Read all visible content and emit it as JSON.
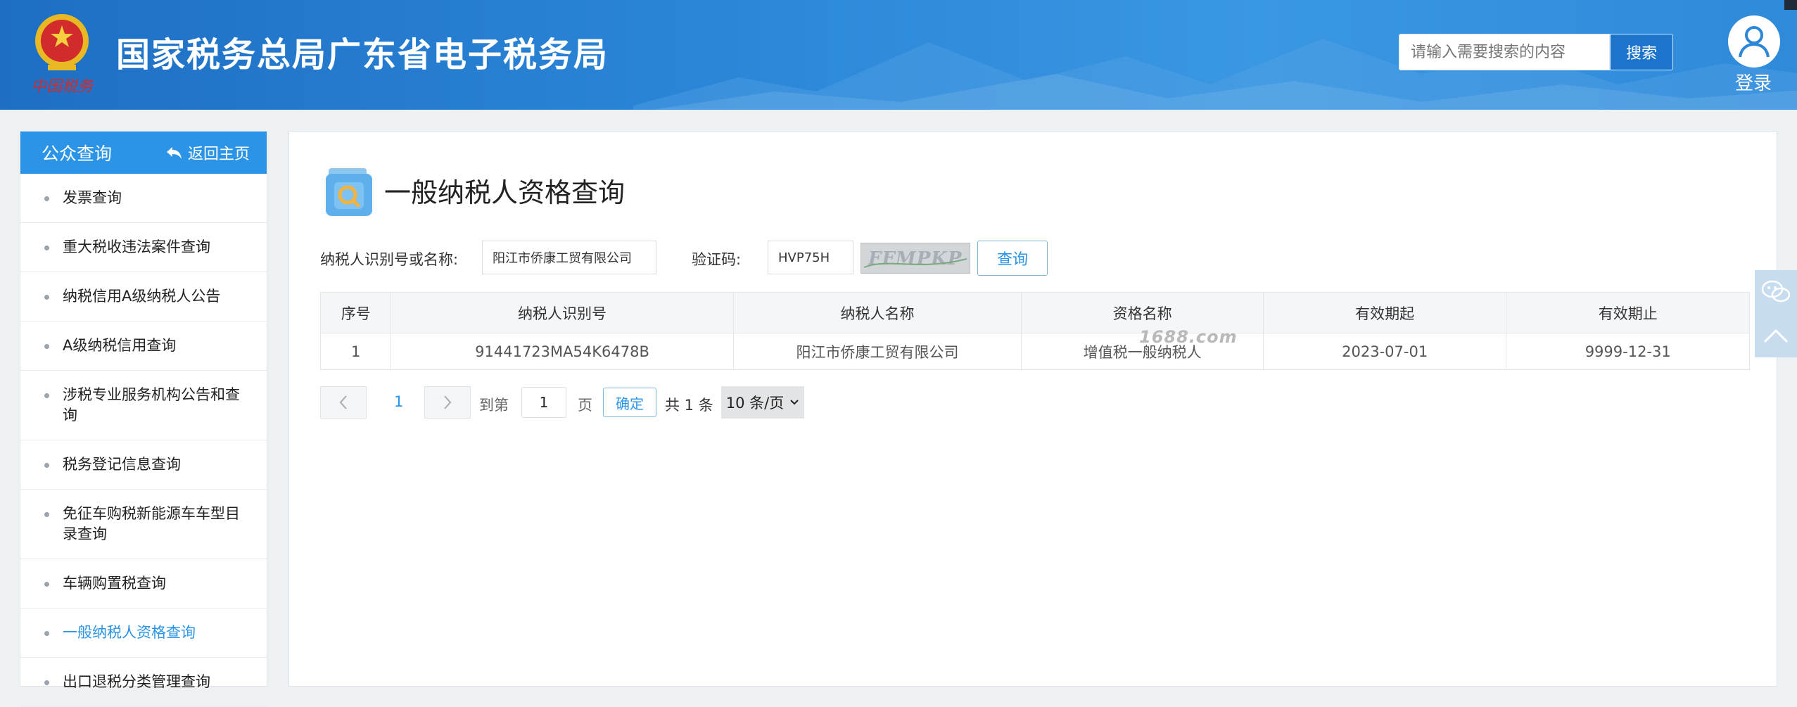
{
  "header": {
    "site_title": "国家税务总局广东省电子税务局",
    "search_placeholder": "请输入需要搜索的内容",
    "search_button": "搜索",
    "login": "登录"
  },
  "sidebar": {
    "title": "公众查询",
    "back_label": "返回主页",
    "items": [
      {
        "label": "发票查询"
      },
      {
        "label": "重大税收违法案件查询"
      },
      {
        "label": "纳税信用A级纳税人公告"
      },
      {
        "label": "A级纳税信用查询"
      },
      {
        "label": "涉税专业服务机构公告和查询"
      },
      {
        "label": "税务登记信息查询"
      },
      {
        "label": "免征车购税新能源车车型目录查询"
      },
      {
        "label": "车辆购置税查询"
      },
      {
        "label": "一般纳税人资格查询"
      },
      {
        "label": "出口退税分类管理查询"
      }
    ],
    "active_index": 8
  },
  "main": {
    "page_title": "一般纳税人资格查询",
    "taxpayer_label": "纳税人识别号或名称:",
    "taxpayer_value": "阳江市侨康工贸有限公司",
    "captcha_label": "验证码:",
    "captcha_value": "HVP75H",
    "captcha_image_text": "FFMPKP",
    "query_button": "查询",
    "table": {
      "headers": [
        "序号",
        "纳税人识别号",
        "纳税人名称",
        "资格名称",
        "有效期起",
        "有效期止"
      ],
      "rows": [
        [
          "1",
          "91441723MA54K6478B",
          "阳江市侨康工贸有限公司",
          "增值税一般纳税人",
          "2023-07-01",
          "9999-12-31"
        ]
      ]
    },
    "watermark": "1688.com",
    "pager": {
      "current_page": "1",
      "goto_label": "到第",
      "goto_value": "1",
      "page_unit": "页",
      "confirm": "确定",
      "total": "共 1 条",
      "page_size": "10 条/页"
    }
  },
  "colors": {
    "header_blue": "#2b86d8",
    "accent": "#2b94e6"
  }
}
